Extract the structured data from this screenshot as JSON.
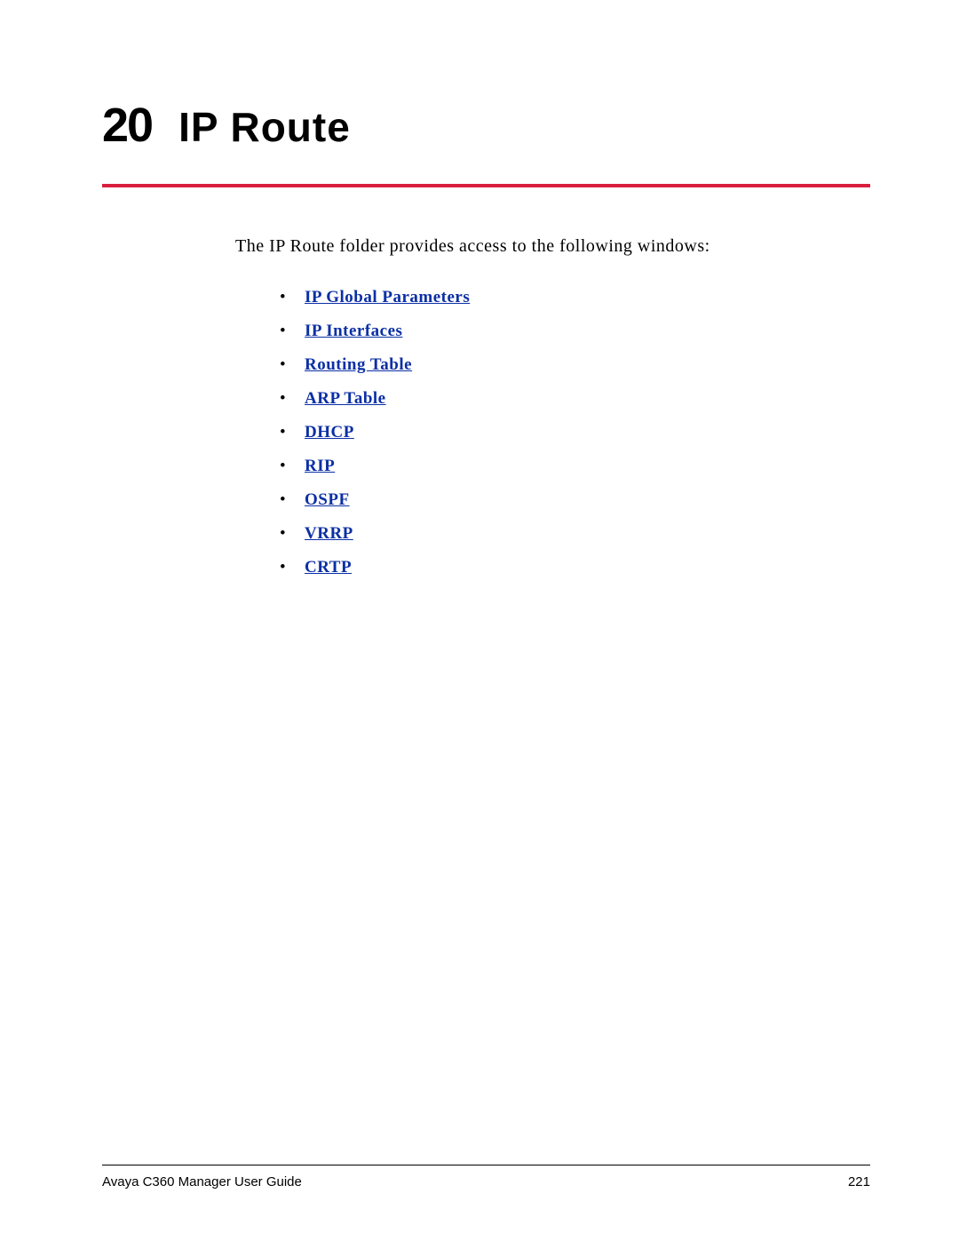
{
  "chapter": {
    "number": "20",
    "title": "IP Route"
  },
  "intro": "The IP Route folder provides access to the following windows:",
  "links": [
    "IP Global Parameters",
    "IP Interfaces",
    "Routing Table",
    "ARP Table",
    "DHCP",
    "RIP",
    "OSPF",
    "VRRP",
    "CRTP"
  ],
  "footer": {
    "doc_title": "Avaya C360 Manager User Guide",
    "page_number": "221"
  }
}
